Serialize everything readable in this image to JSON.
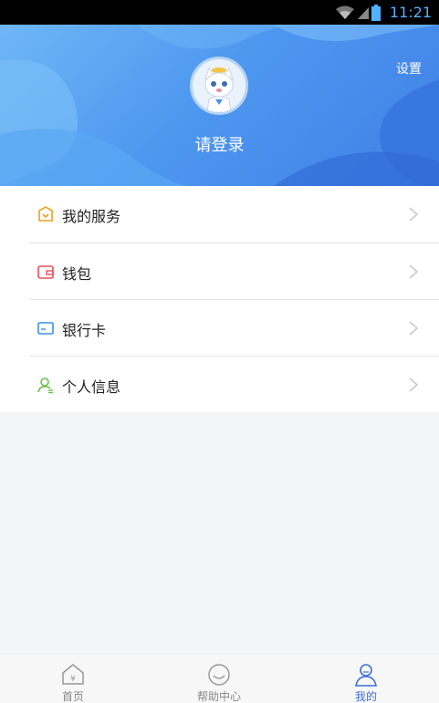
{
  "status_bar": {
    "time": "11:21"
  },
  "header": {
    "settings_label": "设置",
    "login_label": "请登录"
  },
  "menu": {
    "items": [
      {
        "label": "我的服务",
        "icon": "service-icon"
      },
      {
        "label": "钱包",
        "icon": "wallet-icon"
      },
      {
        "label": "银行卡",
        "icon": "bank-card-icon"
      },
      {
        "label": "个人信息",
        "icon": "person-icon"
      }
    ]
  },
  "tabbar": {
    "tabs": [
      {
        "label": "首页",
        "icon": "home-icon",
        "active": false
      },
      {
        "label": "帮助中心",
        "icon": "smile-icon",
        "active": false
      },
      {
        "label": "我的",
        "icon": "user-icon",
        "active": true
      }
    ]
  },
  "colors": {
    "accent": "#3f6fd6",
    "header_blue": "#4e98f0"
  }
}
